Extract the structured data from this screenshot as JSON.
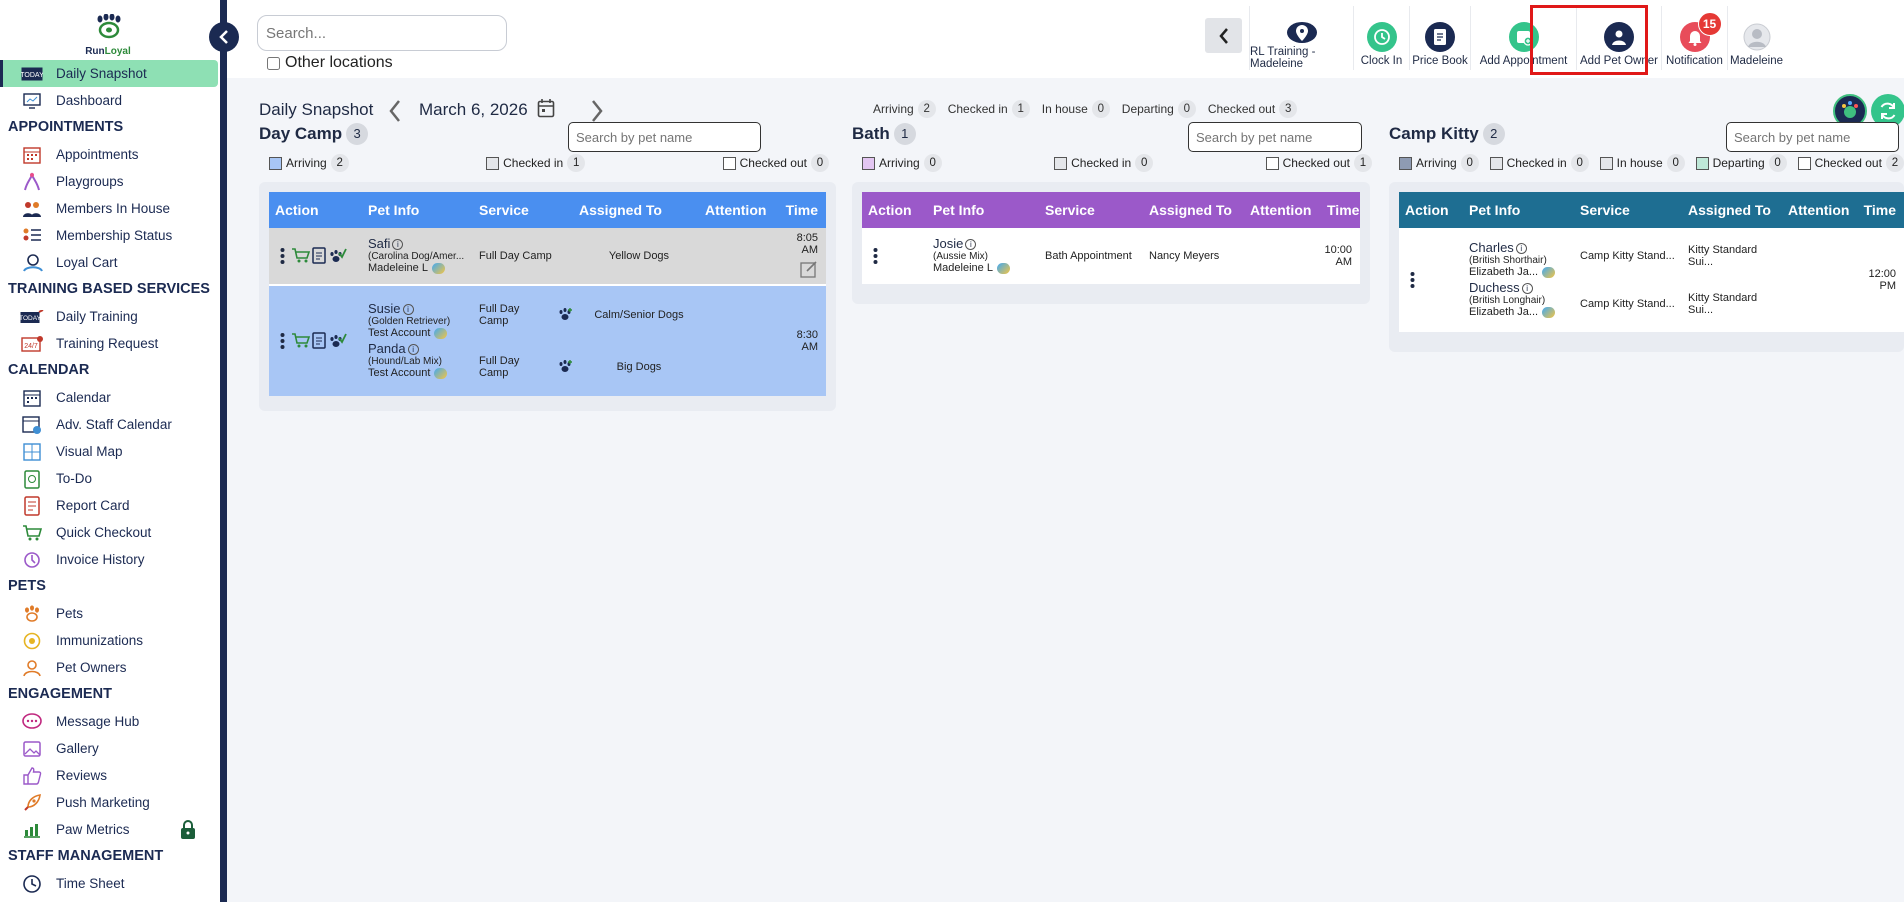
{
  "brand": {
    "name_a": "Run",
    "name_b": "Loyal"
  },
  "sidebar": {
    "items": [
      {
        "type": "item",
        "label": "Daily Snapshot",
        "icon": "today-icon",
        "active": true
      },
      {
        "type": "item",
        "label": "Dashboard",
        "icon": "dashboard-icon"
      },
      {
        "type": "section",
        "label": "APPOINTMENTS"
      },
      {
        "type": "item",
        "label": "Appointments",
        "icon": "appointments-icon"
      },
      {
        "type": "item",
        "label": "Playgroups",
        "icon": "playgroups-icon"
      },
      {
        "type": "item",
        "label": "Members In House",
        "icon": "members-icon"
      },
      {
        "type": "item",
        "label": "Membership Status",
        "icon": "membership-icon"
      },
      {
        "type": "item",
        "label": "Loyal Cart",
        "icon": "cart-icon"
      },
      {
        "type": "section",
        "label": "TRAINING BASED SERVICES"
      },
      {
        "type": "item",
        "label": "Daily Training",
        "icon": "training-icon"
      },
      {
        "type": "item",
        "label": "Training Request",
        "icon": "training-request-icon"
      },
      {
        "type": "section",
        "label": "CALENDAR"
      },
      {
        "type": "item",
        "label": "Calendar",
        "icon": "calendar-icon"
      },
      {
        "type": "item",
        "label": "Adv. Staff Calendar",
        "icon": "staff-calendar-icon"
      },
      {
        "type": "item",
        "label": "Visual Map",
        "icon": "map-icon"
      },
      {
        "type": "item",
        "label": "To-Do",
        "icon": "todo-icon"
      },
      {
        "type": "item",
        "label": "Report Card",
        "icon": "report-icon"
      },
      {
        "type": "item",
        "label": "Quick Checkout",
        "icon": "checkout-icon"
      },
      {
        "type": "item",
        "label": "Invoice History",
        "icon": "invoice-icon"
      },
      {
        "type": "section",
        "label": "PETS"
      },
      {
        "type": "item",
        "label": "Pets",
        "icon": "paw-icon"
      },
      {
        "type": "item",
        "label": "Immunizations",
        "icon": "immunization-icon"
      },
      {
        "type": "item",
        "label": "Pet Owners",
        "icon": "owner-icon"
      },
      {
        "type": "section",
        "label": "ENGAGEMENT"
      },
      {
        "type": "item",
        "label": "Message Hub",
        "icon": "message-icon"
      },
      {
        "type": "item",
        "label": "Gallery",
        "icon": "gallery-icon"
      },
      {
        "type": "item",
        "label": "Reviews",
        "icon": "reviews-icon"
      },
      {
        "type": "item",
        "label": "Push Marketing",
        "icon": "rocket-icon"
      },
      {
        "type": "item",
        "label": "Paw Metrics",
        "icon": "metrics-icon",
        "locked": true
      },
      {
        "type": "section",
        "label": "STAFF MANAGEMENT"
      },
      {
        "type": "item",
        "label": "Time Sheet",
        "icon": "timesheet-icon"
      }
    ]
  },
  "topbar": {
    "search_placeholder": "Search...",
    "other_locations_label": "Other locations",
    "actions": [
      {
        "label": "RL Training - Madeleine",
        "icon": "location-icon",
        "color": "#1b2a52"
      },
      {
        "label": "Clock In",
        "icon": "clock-icon",
        "color": "#34c48b"
      },
      {
        "label": "Price Book",
        "icon": "pricebook-icon",
        "color": "#1b2a52"
      },
      {
        "label": "Add Appointment",
        "icon": "add-appointment-icon",
        "color": "#34c48b"
      },
      {
        "label": "Add Pet Owner",
        "icon": "add-owner-icon",
        "color": "#1b2a52"
      },
      {
        "label": "Notification",
        "icon": "bell-icon",
        "color": "#e84c5a",
        "badge": "15"
      },
      {
        "label": "Madeleine",
        "icon": "avatar-icon",
        "color": "#c9ccd2"
      }
    ]
  },
  "snapshot": {
    "title": "Daily Snapshot",
    "date": "March 6, 2026",
    "stats": [
      {
        "label": "Arriving",
        "value": "2"
      },
      {
        "label": "Checked in",
        "value": "1"
      },
      {
        "label": "In house",
        "value": "0"
      },
      {
        "label": "Departing",
        "value": "0"
      },
      {
        "label": "Checked out",
        "value": "3"
      }
    ]
  },
  "panels": {
    "daycamp": {
      "title": "Day Camp",
      "count": "3",
      "search_placeholder": "Search by pet name",
      "legend": [
        {
          "label": "Arriving",
          "value": "2",
          "color": "#a8c6f5"
        },
        {
          "label": "Checked in",
          "value": "1",
          "color": "#e4e6ea"
        },
        {
          "label": "Checked out",
          "value": "0",
          "color": "#ffffff"
        }
      ],
      "header_color": "#4a8ff0",
      "columns": [
        "Action",
        "Pet Info",
        "Service",
        "Assigned To",
        "Attention",
        "Time"
      ],
      "rows": [
        {
          "bg": "#d9d9d9",
          "pets": [
            {
              "name": "Safi",
              "breed": "(Carolina Dog/Amer...",
              "owner": "Madeleine L",
              "service": "Full Day Camp",
              "assigned": "Yellow Dogs"
            }
          ],
          "time": "8:05 AM"
        },
        {
          "bg": "#a8c6f5",
          "pets": [
            {
              "name": "Susie",
              "breed": "(Golden Retriever)",
              "owner": "Test Account",
              "service": "Full Day Camp",
              "assigned": "Calm/Senior Dogs"
            },
            {
              "name": "Panda",
              "breed": "(Hound/Lab Mix)",
              "owner": "Test Account",
              "service": "Full Day Camp",
              "assigned": "Big Dogs"
            }
          ],
          "time": "8:30 AM"
        }
      ]
    },
    "bath": {
      "title": "Bath",
      "count": "1",
      "search_placeholder": "Search by pet name",
      "legend": [
        {
          "label": "Arriving",
          "value": "0",
          "color": "#e3c6f2"
        },
        {
          "label": "Checked in",
          "value": "0",
          "color": "#e4e6ea"
        },
        {
          "label": "Checked out",
          "value": "1",
          "color": "#ffffff"
        }
      ],
      "header_color": "#9b59c9",
      "columns": [
        "Action",
        "Pet Info",
        "Service",
        "Assigned To",
        "Attention",
        "Time"
      ],
      "rows": [
        {
          "bg": "#ffffff",
          "pets": [
            {
              "name": "Josie",
              "breed": "(Aussie Mix)",
              "owner": "Madeleine L",
              "service": "Bath Appointment",
              "assigned": "Nancy Meyers"
            }
          ],
          "time": "10:00 AM"
        }
      ]
    },
    "campkitty": {
      "title": "Camp Kitty",
      "count": "2",
      "search_placeholder": "Search by pet name",
      "legend": [
        {
          "label": "Arriving",
          "value": "0",
          "color": "#8e9bb3"
        },
        {
          "label": "Checked in",
          "value": "0",
          "color": "#e4e6ea"
        },
        {
          "label": "In house",
          "value": "0",
          "color": "#e4e6ea"
        },
        {
          "label": "Departing",
          "value": "0",
          "color": "#bfe8d8"
        },
        {
          "label": "Checked out",
          "value": "2",
          "color": "#ffffff"
        }
      ],
      "header_color": "#1e6e92",
      "columns": [
        "Action",
        "Pet Info",
        "Service",
        "Assigned To",
        "Attention",
        "Time"
      ],
      "rows": [
        {
          "bg": "#ffffff",
          "pets": [
            {
              "name": "Charles",
              "breed": "(British Shorthair)",
              "owner": "Elizabeth Ja...",
              "service": "Camp Kitty Stand...",
              "assigned": "Kitty Standard Sui..."
            },
            {
              "name": "Duchess",
              "breed": "(British Longhair)",
              "owner": "Elizabeth Ja...",
              "service": "Camp Kitty Stand...",
              "assigned": "Kitty Standard Sui..."
            }
          ],
          "time": "12:00 PM"
        }
      ]
    }
  }
}
